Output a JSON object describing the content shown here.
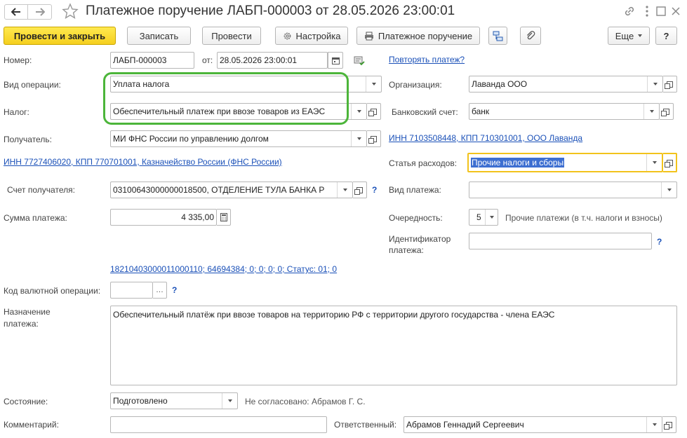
{
  "window": {
    "title": "Платежное поручение ЛАБП-000003 от 28.05.2026 23:00:01"
  },
  "toolbar": {
    "post_close": "Провести и закрыть",
    "save": "Записать",
    "post": "Провести",
    "settings": "Настройка",
    "print_payment": "Платежное поручение",
    "more": "Еще",
    "help": "?"
  },
  "form": {
    "number_label": "Номер:",
    "number_value": "ЛАБП-000003",
    "date_label": "от:",
    "date_value": "28.05.2026 23:00:01",
    "repeat_link": "Повторять платеж?",
    "operation_label": "Вид операции:",
    "operation_value": "Уплата налога",
    "tax_label": "Налог:",
    "tax_value": "Обеспечительный платеж при ввозе товаров из ЕАЭС",
    "recipient_label": "Получатель:",
    "recipient_value": "МИ ФНС России по управлению долгом",
    "recipient_inn_link": "ИНН 7727406020, КПП 770701001, Казначейство России (ФНС России)",
    "recipient_account_label": "Счет получателя:",
    "recipient_account_value": "03100643000000018500, ОТДЕЛЕНИЕ ТУЛА БАНКА Р",
    "amount_label": "Сумма платежа:",
    "amount_value": "4 335,00",
    "kbk_link": "18210403000011000110; 64694384; 0; 0; 0; 0; Статус: 01; 0",
    "currency_code_label": "Код валютной операции:",
    "currency_code_value": "",
    "purpose_label_1": "Назначение",
    "purpose_label_2": "платежа:",
    "purpose_value": "Обеспечительный платёж при ввозе товаров на территорию РФ с территории другого государства - члена ЕАЭС",
    "status_label": "Состояние:",
    "status_value": "Подготовлено",
    "approval_text": "Не согласовано: Абрамов Г. С.",
    "comment_label": "Комментарий:",
    "comment_value": "",
    "responsible_label": "Ответственный:",
    "responsible_value": "Абрамов Геннадий Сергеевич",
    "org_label": "Организация:",
    "org_value": "Лаванда ООО",
    "bank_account_label": "Банковский счет:",
    "bank_account_value": "банк",
    "org_inn_link": "ИНН 7103508448, КПП 710301001, ООО Лаванда",
    "expense_label": "Статья расходов:",
    "expense_value": "Прочие налоги и сборы",
    "payment_type_label": "Вид платежа:",
    "payment_type_value": "",
    "priority_label": "Очередность:",
    "priority_value": "5",
    "priority_text": "Прочие платежи (в т.ч. налоги и взносы)",
    "identifier_label_1": "Идентификатор",
    "identifier_label_2": "платежа:",
    "identifier_value": "",
    "q_mark": "?"
  },
  "colors": {
    "highlight_green": "#4cb53a",
    "focus_yellow": "#f2c31c",
    "link": "#1a50b8",
    "selection": "#3d6fd1"
  }
}
